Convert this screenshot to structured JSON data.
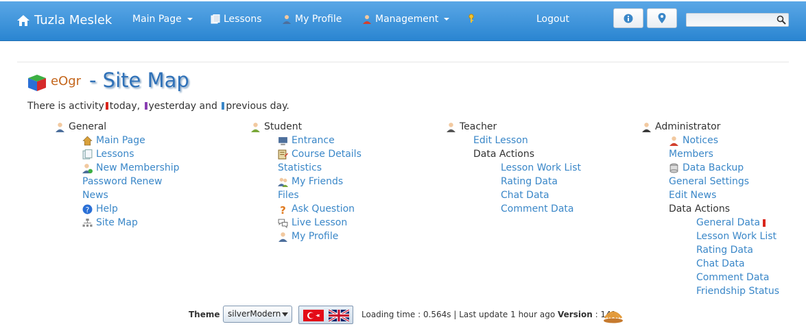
{
  "navbar": {
    "brand": "Tuzla Meslek",
    "items": [
      {
        "label": "Main Page",
        "dropdown": true
      },
      {
        "label": "Lessons"
      },
      {
        "label": "My Profile"
      },
      {
        "label": "Management",
        "dropdown": true
      }
    ],
    "logout": "Logout",
    "search_placeholder": ""
  },
  "header": {
    "logo_text": "eOgr",
    "title": "- Site Map"
  },
  "activity": {
    "prefix": "There is activity",
    "today": "today,",
    "yesterday": "yesterday and",
    "previous": "previous day.",
    "colors": {
      "today": "#d9261c",
      "yesterday": "#8a3fb3",
      "previous": "#3a87c8"
    }
  },
  "sitemap": {
    "general": {
      "heading": "General",
      "items": [
        "Main Page",
        "Lessons",
        "New Membership",
        "Password Renew",
        "News",
        "Help",
        "Site Map"
      ]
    },
    "student": {
      "heading": "Student",
      "items": [
        "Entrance",
        "Course Details",
        "Statistics",
        "My Friends",
        "Files",
        "Ask Question",
        "Live Lesson",
        "My Profile"
      ]
    },
    "teacher": {
      "heading": "Teacher",
      "items": [
        "Edit Lesson"
      ],
      "subheading": "Data Actions",
      "subitems": [
        "Lesson Work List",
        "Rating Data",
        "Chat Data",
        "Comment Data"
      ]
    },
    "administrator": {
      "heading": "Administrator",
      "items": [
        "Notices",
        "Members",
        "Data Backup",
        "General Settings",
        "Edit News"
      ],
      "subheading": "Data Actions",
      "subitems": [
        "General Data",
        "Lesson Work List",
        "Rating Data",
        "Chat Data",
        "Comment Data",
        "Friendship Status"
      ]
    }
  },
  "footer": {
    "theme_label": "Theme :",
    "theme_value": "silverModern",
    "loading": "Loading time : 0.564s | Last update 1 hour ago",
    "version_label": "Version",
    "version_value": ": 141"
  }
}
